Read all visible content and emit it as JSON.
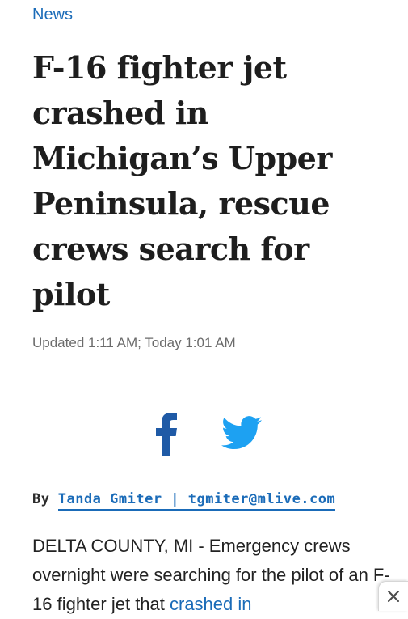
{
  "section": {
    "label": "News"
  },
  "article": {
    "headline": "F-16 fighter jet crashed in Michigan’s Upper Peninsula, rescue crews search for pilot",
    "timestamp": "Updated 1:11 AM; Today 1:01 AM",
    "byline": {
      "prefix": "By",
      "author": "Tanda Gmiter | tgmiter@mlive.com"
    },
    "body": {
      "lead_text": "DELTA COUNTY, MI - Emergency crews overnight were searching for the pilot of an F-16 fighter jet that ",
      "link_text": "crashed in"
    }
  },
  "share": {
    "facebook_icon": "facebook-icon",
    "twitter_icon": "twitter-icon",
    "facebook_color": "#1f5aa6",
    "twitter_color": "#1da1f2"
  },
  "ad": {
    "close_icon": "close-icon"
  },
  "colors": {
    "link": "#1a6bb8",
    "headline": "#1e1e1e",
    "timestamp": "#6b6b6b"
  }
}
